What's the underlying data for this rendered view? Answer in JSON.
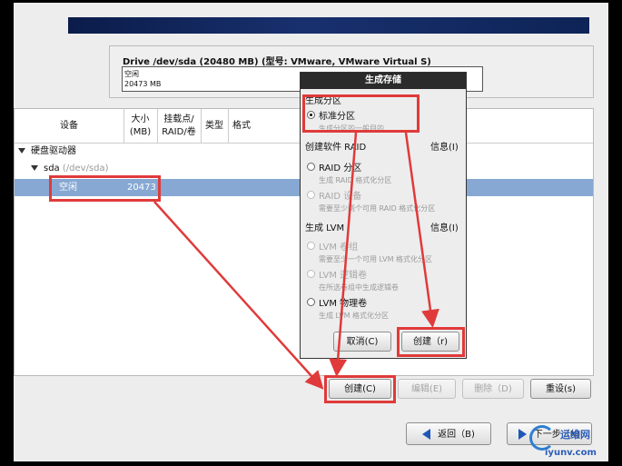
{
  "drive": {
    "title": "Drive /dev/sda (20480 MB) (型号: VMware, VMware Virtual S)",
    "bar_label": "空闲",
    "bar_size": "20473 MB"
  },
  "table": {
    "headers": [
      "设备",
      "大小\n(MB)",
      "挂载点/\nRAID/卷",
      "类型",
      "格式"
    ],
    "rows": {
      "group": "硬盘驱动器",
      "disk_name": "sda",
      "disk_path": "(/dev/sda)",
      "free_label": "空闲",
      "free_size": "20473"
    }
  },
  "buttons": {
    "create": "创建(C)",
    "edit": "编辑(E)",
    "delete": "删除（D)",
    "reset": "重设(s)",
    "back": "返回（B)",
    "next": "下一步（N)"
  },
  "dialog": {
    "title": "生成存储",
    "section1": "生成分区",
    "std_partition": "标准分区",
    "std_partition_desc": "生成分区的一般目的",
    "section2": "创建软件 RAID",
    "info2": "信息(I)",
    "raid_partition": "RAID 分区",
    "raid_partition_desc": "生成 RAID 格式化分区",
    "raid_device": "RAID 设备",
    "raid_device_desc": "需要至少两个可用 RAID 格式化分区",
    "section3": "生成 LVM",
    "info3": "信息(I)",
    "lvm_group": "LVM 卷组",
    "lvm_group_desc": "需要至少一个可用 LVM 格式化分区",
    "lvm_logical": "LVM 逻辑卷",
    "lvm_logical_desc": "在所选卷组中生成逻辑卷",
    "lvm_physical": "LVM 物理卷",
    "lvm_physical_desc": "生成 LVM 格式化分区",
    "cancel": "取消(C)",
    "create": "创建（r)"
  },
  "watermark": {
    "site": "运维网",
    "url": "iyunv.com"
  },
  "colors": {
    "selection": "#86a8d3",
    "annotation": "#e03a3a",
    "banner": "#18306e"
  }
}
